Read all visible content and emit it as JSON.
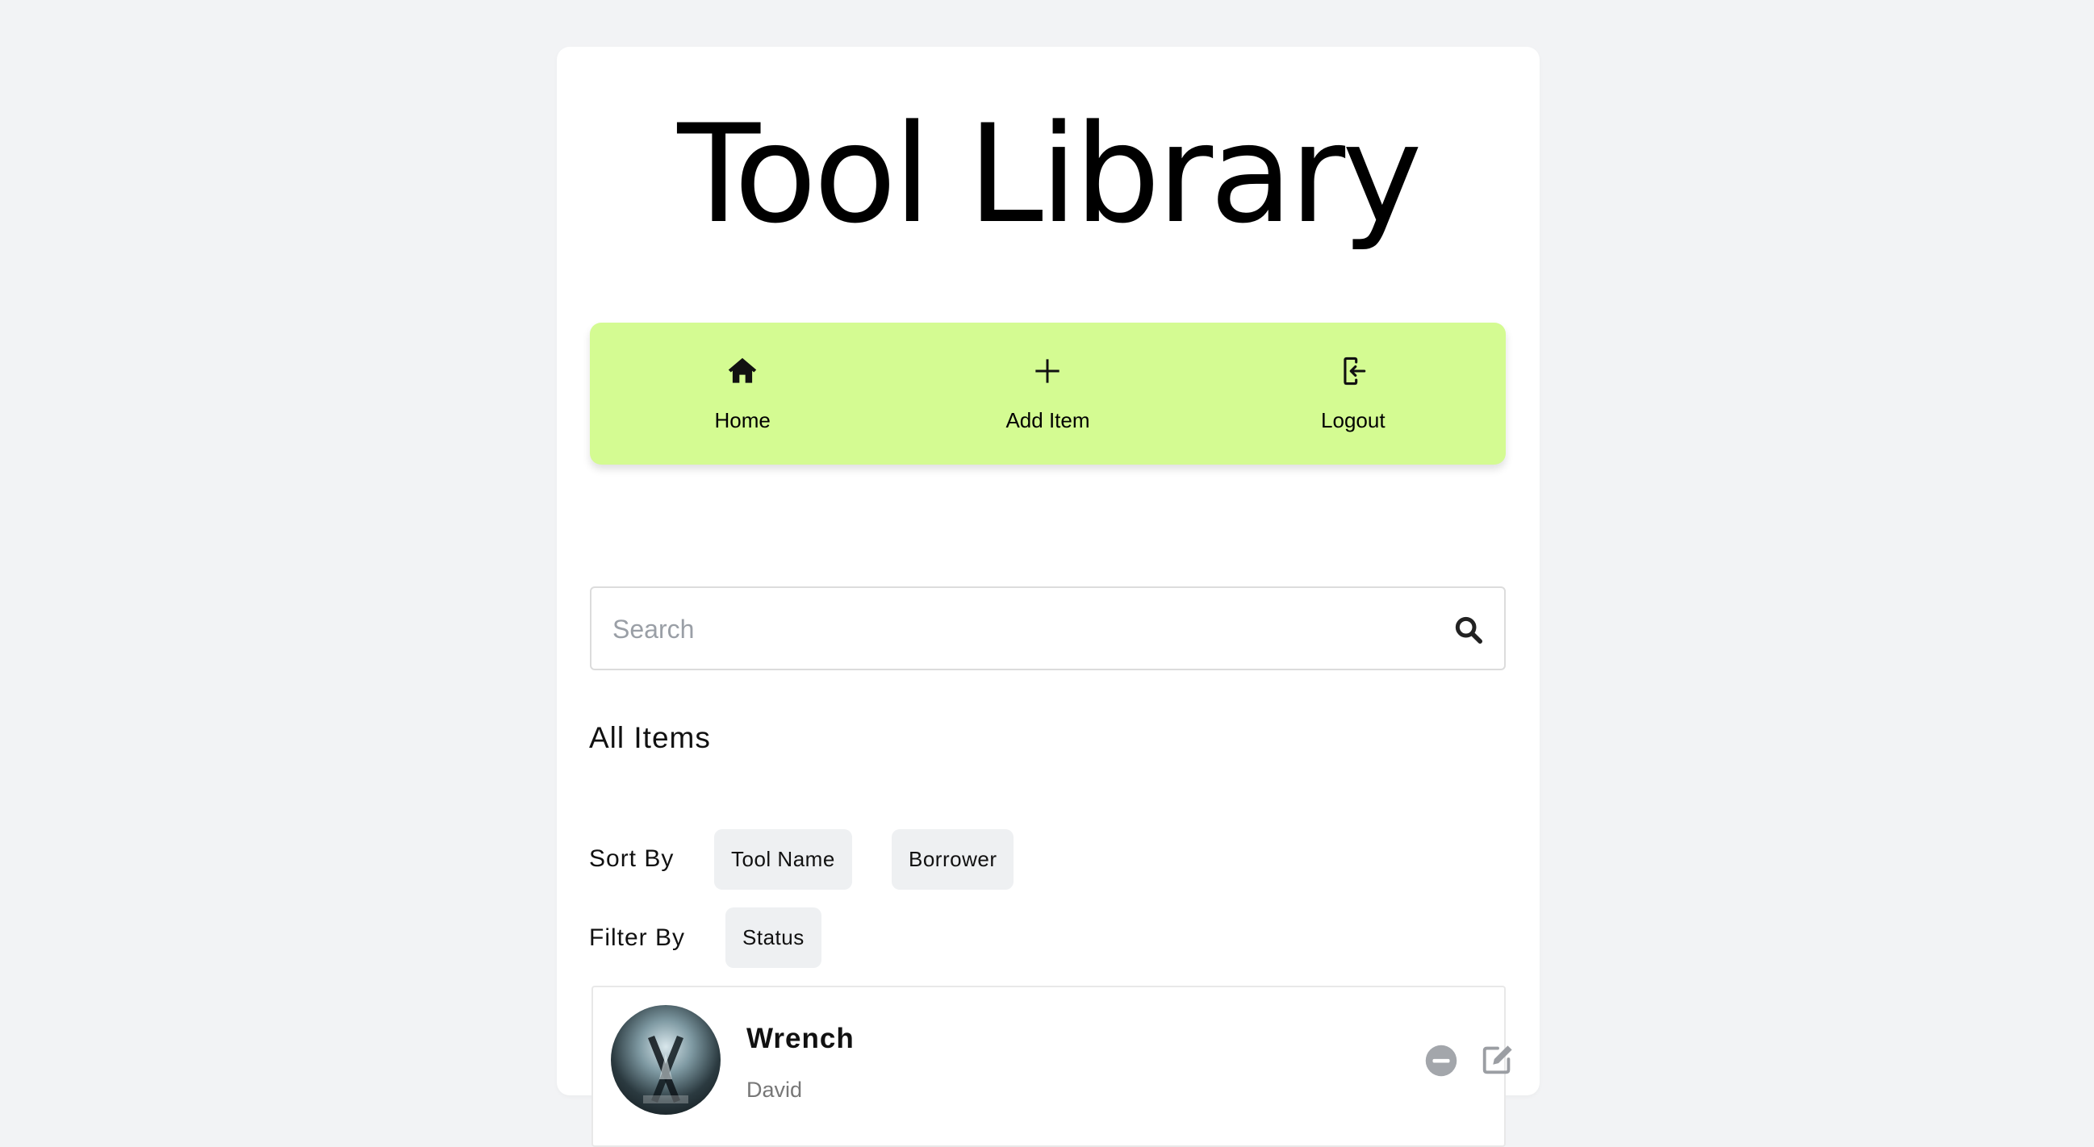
{
  "app": {
    "title": "Tool Library"
  },
  "nav": {
    "items": [
      {
        "label": "Home",
        "icon": "home-icon"
      },
      {
        "label": "Add Item",
        "icon": "plus-icon"
      },
      {
        "label": "Logout",
        "icon": "logout-icon"
      }
    ],
    "background": "#d4fb92"
  },
  "search": {
    "placeholder": "Search",
    "value": "",
    "icon": "search-icon"
  },
  "items_section": {
    "title": "All Items",
    "sort": {
      "label": "Sort By",
      "options": [
        "Tool Name",
        "Borrower"
      ]
    },
    "filter": {
      "label": "Filter By",
      "options": [
        "Status"
      ]
    },
    "list": [
      {
        "name": "Wrench",
        "borrower": "David",
        "icons": [
          "remove-icon",
          "edit-icon"
        ]
      }
    ]
  }
}
